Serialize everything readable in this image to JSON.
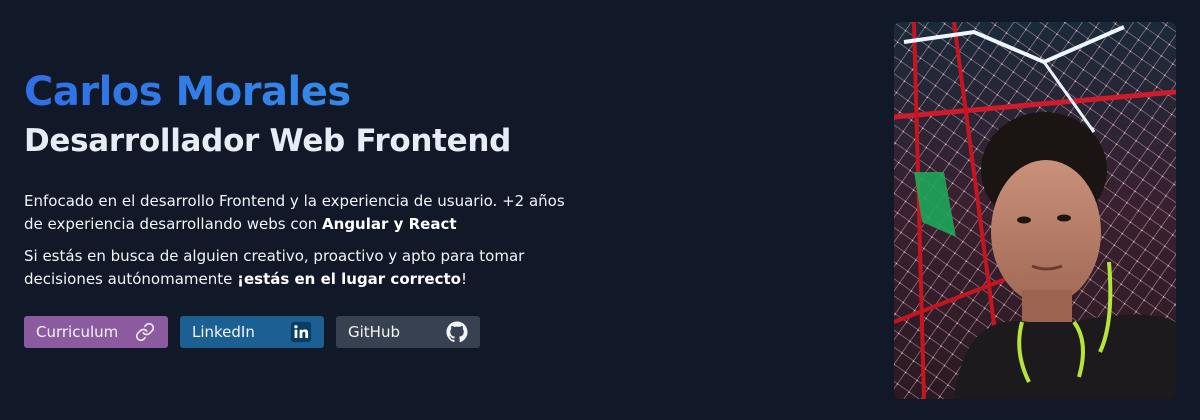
{
  "profile": {
    "name": "Carlos Morales",
    "role": "Desarrollador Web Frontend"
  },
  "description": {
    "p1_text": "Enfocado en el desarrollo Frontend y la experiencia de usuario. +2 años de experiencia desarrollando webs con ",
    "p1_bold": "Angular y React",
    "p2_text": "Si estás en busca de alguien creativo, proactivo y apto para tomar decisiones autónomamente ",
    "p2_bold": "¡estás en el lugar correcto",
    "p2_end": "!"
  },
  "buttons": {
    "curriculum": {
      "label": "Curriculum",
      "icon": "link-icon",
      "color": "#8b5a9f"
    },
    "linkedin": {
      "label": "LinkedIn",
      "icon": "linkedin-icon",
      "color": "#1b5f93"
    },
    "github": {
      "label": "GitHub",
      "icon": "github-icon",
      "color": "#374151"
    }
  },
  "photo": {
    "subject": "profile-photo"
  },
  "colors": {
    "background": "#111827",
    "name_gradient_start": "#2f6fe6",
    "name_gradient_end": "#3aa0e8"
  }
}
